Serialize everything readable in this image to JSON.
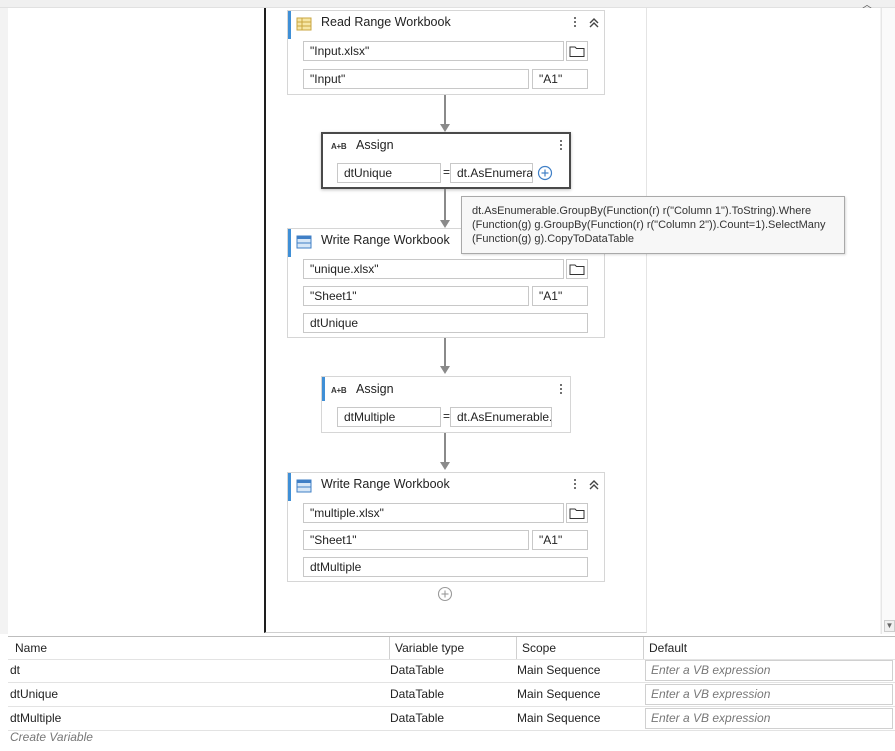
{
  "activities": {
    "read_range": {
      "title": "Read Range Workbook",
      "path": "\"Input.xlsx\"",
      "sheet": "\"Input\"",
      "range": "\"A1\""
    },
    "assign_unique": {
      "title": "Assign",
      "icon_text": "A+B",
      "to": "dtUnique",
      "equals": "=",
      "value": "dt.AsEnumerat"
    },
    "tooltip": {
      "line1": "dt.AsEnumerable.GroupBy(Function(r) r(\"Column 1\").ToString).Where",
      "line2": "(Function(g) g.GroupBy(Function(r) r(\"Column 2\")).Count=1).SelectMany",
      "line3": "(Function(g) g).CopyToDataTable"
    },
    "write_unique": {
      "title": "Write Range Workbook",
      "path": "\"unique.xlsx\"",
      "sheet": "\"Sheet1\"",
      "range": "\"A1\"",
      "datatable": "dtUnique"
    },
    "assign_multiple": {
      "title": "Assign",
      "icon_text": "A+B",
      "to": "dtMultiple",
      "equals": "=",
      "value": "dt.AsEnumerable.C"
    },
    "write_multiple": {
      "title": "Write Range Workbook",
      "path": "\"multiple.xlsx\"",
      "sheet": "\"Sheet1\"",
      "range": "\"A1\"",
      "datatable": "dtMultiple"
    }
  },
  "variables": {
    "headers": {
      "name": "Name",
      "type": "Variable type",
      "scope": "Scope",
      "default": "Default"
    },
    "rows": [
      {
        "name": "dt",
        "type": "DataTable",
        "scope": "Main Sequence",
        "default": "Enter a VB expression"
      },
      {
        "name": "dtUnique",
        "type": "DataTable",
        "scope": "Main Sequence",
        "default": "Enter a VB expression"
      },
      {
        "name": "dtMultiple",
        "type": "DataTable",
        "scope": "Main Sequence",
        "default": "Enter a VB expression"
      }
    ],
    "create_label": "Create Variable"
  },
  "icons": {
    "excel_read": "excel-read-icon",
    "excel_write": "excel-write-icon",
    "folder": "folder-icon",
    "kebab": "kebab-menu-icon",
    "collapse": "chevron-up-icon",
    "add": "add-circle-icon"
  },
  "colors": {
    "accent": "#3f8fd6",
    "selected_border": "#4a4a4a",
    "arrow": "#8a8a8a"
  }
}
